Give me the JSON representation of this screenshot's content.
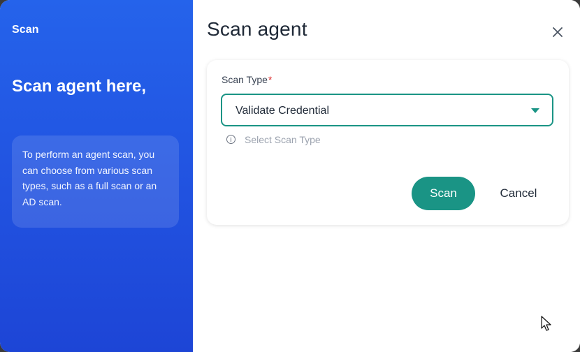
{
  "sidebar": {
    "title": "Scan",
    "heading": "Scan agent here,",
    "info": "To perform an agent scan, you can choose from various scan types, such as a full scan or an AD scan."
  },
  "dialog": {
    "title": "Scan agent",
    "close_icon": "close-icon"
  },
  "form": {
    "scan_type_label": "Scan Type",
    "required_marker": "*",
    "scan_type_value": "Validate Credential",
    "scan_type_hint": "Select Scan Type",
    "hint_icon": "info-icon",
    "caret_icon": "caret-down-icon"
  },
  "actions": {
    "scan_label": "Scan",
    "cancel_label": "Cancel"
  },
  "colors": {
    "sidebar_blue": "#2563eb",
    "accent_teal": "#1a9485",
    "required_red": "#dc2626"
  }
}
